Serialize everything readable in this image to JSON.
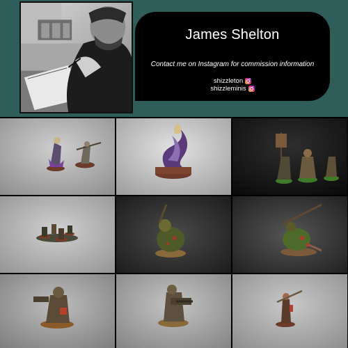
{
  "profile": {
    "name": "James Shelton",
    "tagline": "Contact me on Instagram for commission information",
    "handles": [
      {
        "label": "shizzleton",
        "icon": "instagram-icon"
      },
      {
        "label": "shizzleminis",
        "icon": "instagram-icon"
      }
    ]
  },
  "colors": {
    "header_bg": "#2f5d59",
    "card_bg": "#000000",
    "page_bg": "#000000"
  },
  "gallery": {
    "count": 9
  }
}
